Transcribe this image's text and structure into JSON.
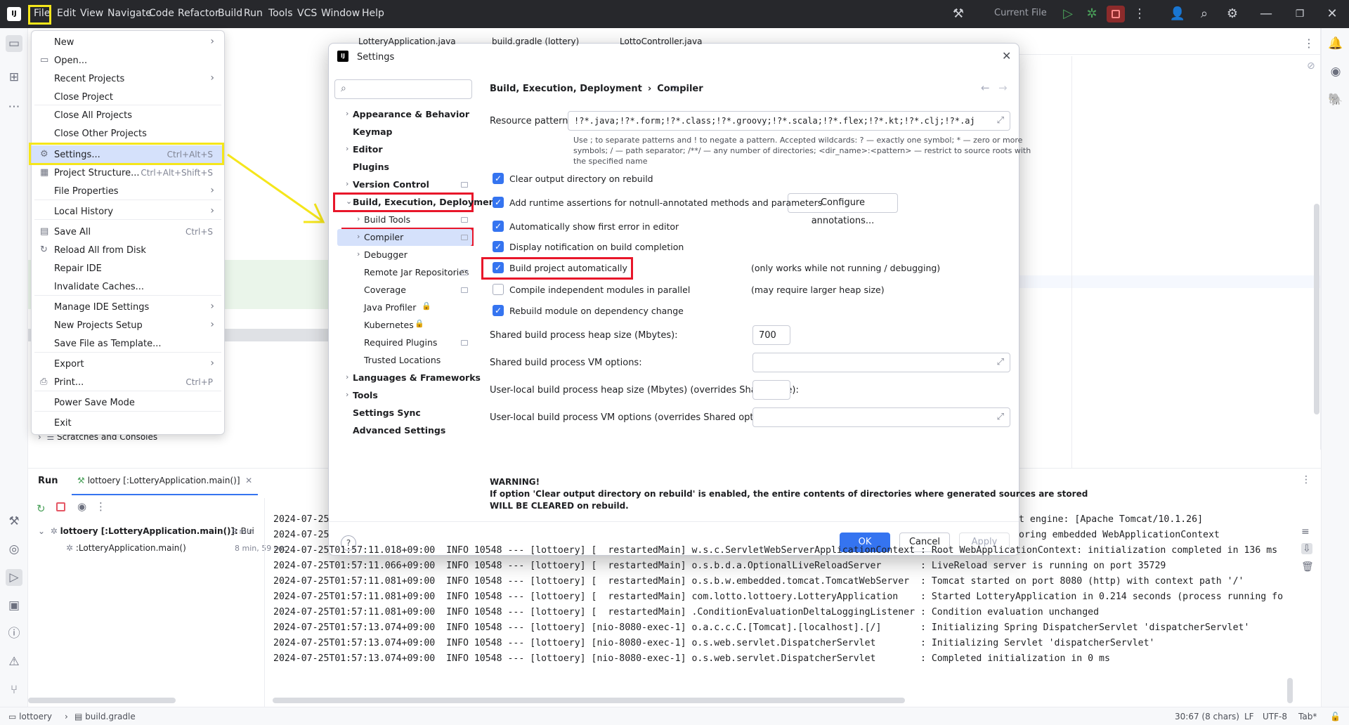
{
  "menubar": {
    "items": [
      "File",
      "Edit",
      "View",
      "Navigate",
      "Code",
      "Refactor",
      "Build",
      "Run",
      "Tools",
      "VCS",
      "Window",
      "Help"
    ],
    "run_config": "Current File"
  },
  "editor_tabs": [
    "LotteryApplication.java",
    "build.gradle (lottery)",
    "LottoController.java"
  ],
  "file_menu": [
    {
      "label": "New",
      "shortcut": "",
      "submenu": true,
      "icon": ""
    },
    {
      "label": "Open...",
      "shortcut": "",
      "submenu": false,
      "icon": "folder-icon"
    },
    {
      "label": "Recent Projects",
      "shortcut": "",
      "submenu": true,
      "icon": ""
    },
    {
      "label": "Close Project",
      "shortcut": "",
      "submenu": false,
      "icon": ""
    },
    {
      "label": "Close All Projects",
      "shortcut": "",
      "submenu": false,
      "icon": ""
    },
    {
      "label": "Close Other Projects",
      "shortcut": "",
      "submenu": false,
      "icon": ""
    },
    {
      "label": "Settings...",
      "shortcut": "Ctrl+Alt+S",
      "submenu": false,
      "icon": "gear-icon"
    },
    {
      "label": "Project Structure...",
      "shortcut": "Ctrl+Alt+Shift+S",
      "submenu": false,
      "icon": "project-structure-icon"
    },
    {
      "label": "File Properties",
      "shortcut": "",
      "submenu": true,
      "icon": ""
    },
    {
      "label": "Local History",
      "shortcut": "",
      "submenu": true,
      "icon": ""
    },
    {
      "label": "Save All",
      "shortcut": "Ctrl+S",
      "submenu": false,
      "icon": "save-icon"
    },
    {
      "label": "Reload All from Disk",
      "shortcut": "",
      "submenu": false,
      "icon": "reload-icon"
    },
    {
      "label": "Repair IDE",
      "shortcut": "",
      "submenu": false,
      "icon": ""
    },
    {
      "label": "Invalidate Caches...",
      "shortcut": "",
      "submenu": false,
      "icon": ""
    },
    {
      "label": "Manage IDE Settings",
      "shortcut": "",
      "submenu": true,
      "icon": ""
    },
    {
      "label": "New Projects Setup",
      "shortcut": "",
      "submenu": true,
      "icon": ""
    },
    {
      "label": "Save File as Template...",
      "shortcut": "",
      "submenu": false,
      "icon": ""
    },
    {
      "label": "Export",
      "shortcut": "",
      "submenu": true,
      "icon": ""
    },
    {
      "label": "Print...",
      "shortcut": "Ctrl+P",
      "submenu": false,
      "icon": "print-icon"
    },
    {
      "label": "Power Save Mode",
      "shortcut": "",
      "submenu": false,
      "icon": ""
    },
    {
      "label": "Exit",
      "shortcut": "",
      "submenu": false,
      "icon": ""
    }
  ],
  "project_tree_item": "Scratches and Consoles",
  "settings": {
    "title": "Settings",
    "search_placeholder": "",
    "breadcrumb": [
      "Build, Execution, Deployment",
      "Compiler"
    ],
    "tree": [
      {
        "label": "Appearance & Behavior",
        "bold": true,
        "level": 0,
        "arrow": "›",
        "pin": false,
        "lock": false
      },
      {
        "label": "Keymap",
        "bold": true,
        "level": 0,
        "arrow": "",
        "pin": false,
        "lock": false
      },
      {
        "label": "Editor",
        "bold": true,
        "level": 0,
        "arrow": "›",
        "pin": false,
        "lock": false
      },
      {
        "label": "Plugins",
        "bold": true,
        "level": 0,
        "arrow": "",
        "pin": false,
        "lock": false
      },
      {
        "label": "Version Control",
        "bold": true,
        "level": 0,
        "arrow": "›",
        "pin": true,
        "lock": false
      },
      {
        "label": "Build, Execution, Deployment",
        "bold": true,
        "level": 0,
        "arrow": "⌄",
        "pin": false,
        "lock": false
      },
      {
        "label": "Build Tools",
        "bold": false,
        "level": 1,
        "arrow": "›",
        "pin": true,
        "lock": false
      },
      {
        "label": "Compiler",
        "bold": false,
        "level": 1,
        "arrow": "›",
        "pin": true,
        "lock": false
      },
      {
        "label": "Debugger",
        "bold": false,
        "level": 1,
        "arrow": "›",
        "pin": false,
        "lock": false
      },
      {
        "label": "Remote Jar Repositories",
        "bold": false,
        "level": 1,
        "arrow": "",
        "pin": true,
        "lock": false
      },
      {
        "label": "Coverage",
        "bold": false,
        "level": 1,
        "arrow": "",
        "pin": true,
        "lock": false
      },
      {
        "label": "Java Profiler",
        "bold": false,
        "level": 1,
        "arrow": "",
        "pin": false,
        "lock": true
      },
      {
        "label": "Kubernetes",
        "bold": false,
        "level": 1,
        "arrow": "",
        "pin": false,
        "lock": true
      },
      {
        "label": "Required Plugins",
        "bold": false,
        "level": 1,
        "arrow": "",
        "pin": true,
        "lock": false
      },
      {
        "label": "Trusted Locations",
        "bold": false,
        "level": 1,
        "arrow": "",
        "pin": false,
        "lock": false
      },
      {
        "label": "Languages & Frameworks",
        "bold": true,
        "level": 0,
        "arrow": "›",
        "pin": false,
        "lock": false
      },
      {
        "label": "Tools",
        "bold": true,
        "level": 0,
        "arrow": "›",
        "pin": false,
        "lock": false
      },
      {
        "label": "Settings Sync",
        "bold": true,
        "level": 0,
        "arrow": "",
        "pin": false,
        "lock": false
      },
      {
        "label": "Advanced Settings",
        "bold": true,
        "level": 0,
        "arrow": "",
        "pin": false,
        "lock": false
      }
    ],
    "resource_patterns_label": "Resource patterns:",
    "resource_patterns_value": "!?*.java;!?*.form;!?*.class;!?*.groovy;!?*.scala;!?*.flex;!?*.kt;!?*.clj;!?*.aj",
    "resource_hint_1": "Use ; to separate patterns and ! to negate a pattern. Accepted wildcards: ? — exactly one symbol; * — zero or more",
    "resource_hint_2": "symbols; / — path separator; /**/ — any number of directories; <dir_name>:<pattern> — restrict to source roots with",
    "resource_hint_3": "the specified name",
    "options": [
      {
        "label": "Clear output directory on rebuild",
        "checked": true,
        "note": ""
      },
      {
        "label": "Add runtime assertions for notnull-annotated methods and parameters",
        "checked": true,
        "note": ""
      },
      {
        "label": "Automatically show first error in editor",
        "checked": true,
        "note": ""
      },
      {
        "label": "Display notification on build completion",
        "checked": true,
        "note": ""
      },
      {
        "label": "Build project automatically",
        "checked": true,
        "note": "(only works while not running / debugging)"
      },
      {
        "label": "Compile independent modules in parallel",
        "checked": false,
        "note": "(may require larger heap size)"
      },
      {
        "label": "Rebuild module on dependency change",
        "checked": true,
        "note": ""
      }
    ],
    "configure_annotations": "Configure annotations...",
    "heap_label": "Shared build process heap size (Mbytes):",
    "heap_value": "700",
    "vm_label": "Shared build process VM options:",
    "user_heap_label": "User-local build process heap size (Mbytes) (overrides Shared size):",
    "user_vm_label": "User-local build process VM options (overrides Shared options):",
    "warning_title": "WARNING!",
    "warning_line1": "If option 'Clear output directory on rebuild' is enabled, the entire contents of directories where generated sources are stored",
    "warning_line2": "WILL BE CLEARED on rebuild.",
    "ok": "OK",
    "cancel": "Cancel",
    "apply": "Apply",
    "help": "?"
  },
  "run_panel": {
    "tab_run": "Run",
    "tab_config": "lottoery [:LotteryApplication.main()]",
    "tree_root": "lottoery [:LotteryApplication.main()]:",
    "tree_root_suffix": "Bui",
    "tree_root_time": "9 min",
    "tree_child": ":LotteryApplication.main()",
    "tree_child_time": "8 min, 59 sec",
    "logs_partial": [
      {
        "left": "2024-07-25",
        "right": "t engine: [Apache Tomcat/10.1.26]"
      },
      {
        "left": "2024-07-25",
        "right": "oring embedded WebApplicationContext"
      }
    ],
    "logs": [
      "2024-07-25T01:57:11.018+09:00  INFO 10548 --- [lottoery] [  restartedMain] w.s.c.ServletWebServerApplicationContext : Root WebApplicationContext: initialization completed in 136 ms",
      "2024-07-25T01:57:11.066+09:00  INFO 10548 --- [lottoery] [  restartedMain] o.s.b.d.a.OptionalLiveReloadServer       : LiveReload server is running on port 35729",
      "2024-07-25T01:57:11.081+09:00  INFO 10548 --- [lottoery] [  restartedMain] o.s.b.w.embedded.tomcat.TomcatWebServer  : Tomcat started on port 8080 (http) with context path '/'",
      "2024-07-25T01:57:11.081+09:00  INFO 10548 --- [lottoery] [  restartedMain] com.lotto.lottoery.LotteryApplication    : Started LotteryApplication in 0.214 seconds (process running fo",
      "2024-07-25T01:57:11.081+09:00  INFO 10548 --- [lottoery] [  restartedMain] .ConditionEvaluationDeltaLoggingListener : Condition evaluation unchanged",
      "2024-07-25T01:57:13.074+09:00  INFO 10548 --- [lottoery] [nio-8080-exec-1] o.a.c.c.C.[Tomcat].[localhost].[/]       : Initializing Spring DispatcherServlet 'dispatcherServlet'",
      "2024-07-25T01:57:13.074+09:00  INFO 10548 --- [lottoery] [nio-8080-exec-1] o.s.web.servlet.DispatcherServlet        : Initializing Servlet 'dispatcherServlet'",
      "2024-07-25T01:57:13.074+09:00  INFO 10548 --- [lottoery] [nio-8080-exec-1] o.s.web.servlet.DispatcherServlet        : Completed initialization in 0 ms"
    ]
  },
  "statusbar": {
    "project": "lottoery",
    "file": "build.gradle",
    "position": "30:67 (8 chars)",
    "line_sep": "LF",
    "encoding": "UTF-8",
    "indent": "Tab*"
  },
  "colors": {
    "accent": "#3574f0",
    "highlight_red": "#e8162a",
    "highlight_yellow": "#f5e61b"
  }
}
